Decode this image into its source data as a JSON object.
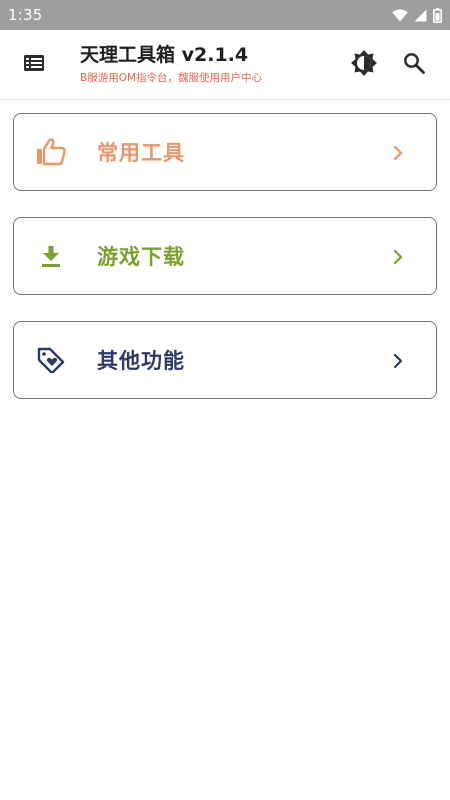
{
  "status_bar": {
    "time": "1:35",
    "icons": [
      "wifi-icon",
      "signal-icon",
      "battery-icon"
    ]
  },
  "app_bar": {
    "title": "天理工具箱 v2.1.4",
    "subtitle": "B服游用OM指令台，魏服使用用户中心",
    "menu_icon": "list-icon",
    "theme_icon": "brightness-icon",
    "search_icon": "search-icon"
  },
  "cards": [
    {
      "label": "常用工具",
      "icon": "thumbs-up-icon",
      "color": "#e8966a"
    },
    {
      "label": "游戏下载",
      "icon": "download-icon",
      "color": "#7ba02d"
    },
    {
      "label": "其他功能",
      "icon": "tag-heart-icon",
      "color": "#2c3a66"
    }
  ],
  "colors": {
    "status_bar": "#9e9e9e",
    "subtitle": "#e0674f",
    "card_border": "#6f6f6f"
  }
}
